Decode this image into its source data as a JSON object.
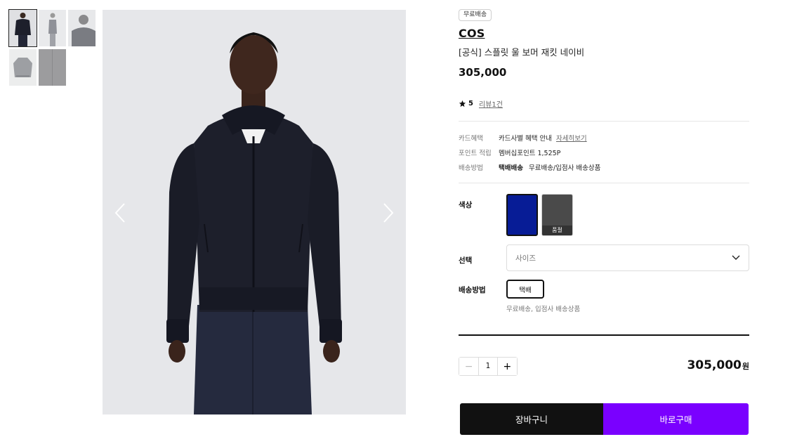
{
  "gallery": {
    "thumbnails": [
      "front-view",
      "side-view",
      "detail-view",
      "flat-front",
      "fabric-detail"
    ],
    "main_image": "model-wearing-navy-bomber-jacket",
    "prev_icon": "chevron-left-icon",
    "next_icon": "chevron-right-icon"
  },
  "product": {
    "badge": "무료배송",
    "brand": "COS",
    "name": "[공식] 스플릿 울 보머 재킷 네이비",
    "price": "305,000",
    "rating_score": "5",
    "review_link": "리뷰1건"
  },
  "benefits": {
    "card_label": "카드혜택",
    "card_value": "카드사별 혜택 안내",
    "card_detail_link": "자세히보기",
    "point_label": "포인트 적립",
    "point_value": "멤버십포인트 1,525P",
    "delivery_label": "배송방법",
    "delivery_method": "택배배송",
    "delivery_value": "무료배송/입점사 배송상품"
  },
  "options": {
    "color_label": "색상",
    "colors": [
      {
        "hex": "#071c96",
        "selected": true,
        "soldout": false
      },
      {
        "hex": "#4a4a4a",
        "selected": false,
        "soldout": true
      }
    ],
    "soldout_text": "품절",
    "select_label": "선택",
    "size_placeholder": "사이즈",
    "shipping_label": "배송방법",
    "shipping_option": "택배",
    "shipping_note": "무료배송, 입점사 배송상품"
  },
  "purchase": {
    "minus": "−",
    "quantity": "1",
    "plus": "+",
    "total_amount": "305,000",
    "total_unit": "원",
    "cart_button": "장바구니",
    "buy_button": "바로구매"
  },
  "colors": {
    "accent": "#7a00ff",
    "dark": "#111111"
  }
}
